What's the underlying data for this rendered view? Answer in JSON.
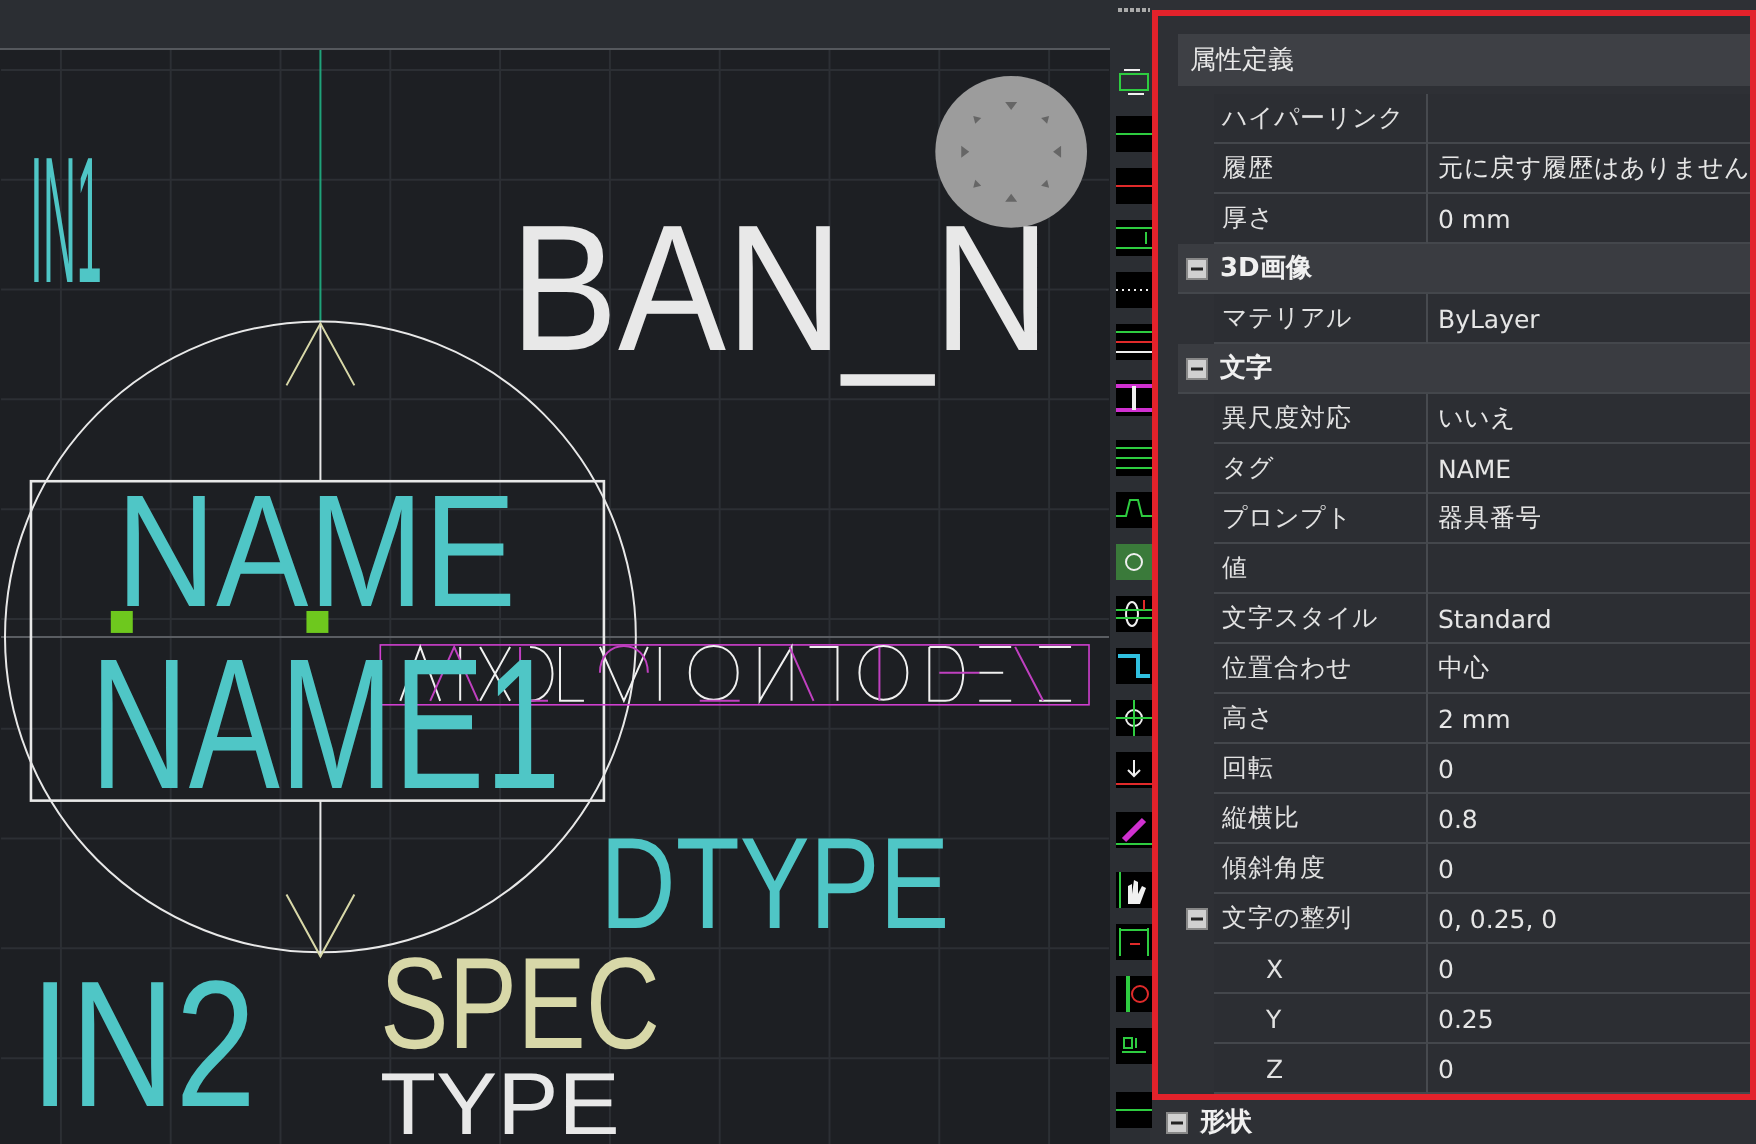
{
  "canvas": {
    "labels": [
      {
        "text": "IN1",
        "color": "#4fc6c6"
      },
      {
        "text": "BAN_N",
        "color": "#e8e8e8"
      },
      {
        "text": "NAME",
        "color": "#4fc6c6"
      },
      {
        "text": "NAME1",
        "color": "#4fc6c6"
      },
      {
        "text": "DTYPE",
        "color": "#4fc6c6"
      },
      {
        "text": "IN2",
        "color": "#4fc6c6"
      },
      {
        "text": "SPEC",
        "color": "#d8d8a8"
      },
      {
        "text": "TYPE",
        "color": "#e8e8e8"
      }
    ]
  },
  "properties": {
    "title": "属性定義",
    "items": [
      {
        "kind": "property",
        "label": "ハイパーリンク"
      },
      {
        "kind": "property",
        "label": "履歴",
        "value": "元に戻す履歴はありません"
      },
      {
        "kind": "property",
        "label": "厚さ",
        "value": "0 mm"
      },
      {
        "kind": "category",
        "label": "3D画像",
        "expanded": true,
        "children": [
          {
            "kind": "property",
            "label": "マテリアル",
            "value": "ByLayer"
          }
        ]
      },
      {
        "kind": "category",
        "label": "文字",
        "expanded": true,
        "children": [
          {
            "kind": "property",
            "label": "異尺度対応",
            "value": "いいえ"
          },
          {
            "kind": "property",
            "label": "タグ",
            "value": "NAME"
          },
          {
            "kind": "property",
            "label": "プロンプト",
            "value": "器具番号"
          },
          {
            "kind": "property",
            "label": "値"
          },
          {
            "kind": "property",
            "label": "文字スタイル",
            "value": "Standard"
          },
          {
            "kind": "property",
            "label": "位置合わせ",
            "value": "中心"
          },
          {
            "kind": "property",
            "label": "高さ",
            "value": "2 mm"
          },
          {
            "kind": "property",
            "label": "回転",
            "value": "0"
          },
          {
            "kind": "property",
            "label": "縦横比",
            "value": "0.8"
          },
          {
            "kind": "property",
            "label": "傾斜角度",
            "value": "0"
          },
          {
            "kind": "group",
            "label": "文字の整列",
            "value": "0, 0.25, 0",
            "expanded": true,
            "children": [
              {
                "kind": "property",
                "label": "X",
                "value": "0"
              },
              {
                "kind": "property",
                "label": "Y",
                "value": "0.25"
              },
              {
                "kind": "property",
                "label": "Z",
                "value": "0"
              }
            ]
          }
        ]
      }
    ]
  },
  "below_frame": [
    {
      "kind": "category",
      "label": "形状",
      "expanded": true
    }
  ]
}
